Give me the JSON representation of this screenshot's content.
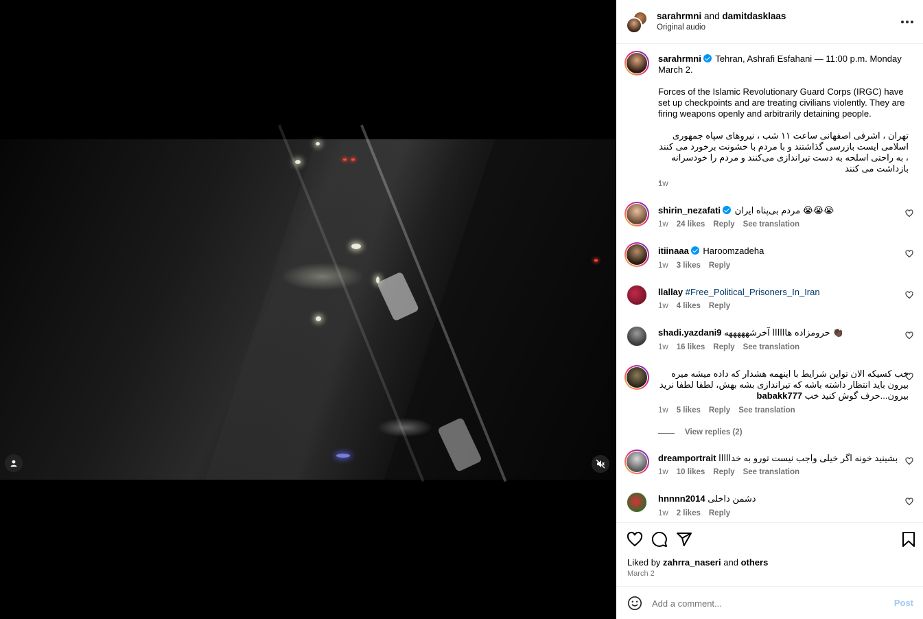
{
  "header": {
    "user1": "sarahrmni",
    "connector": "and",
    "user2": "damitdasklaas",
    "audio": "Original audio",
    "more_icon": "more-horizontal-icon"
  },
  "caption": {
    "username": "sarahrmni",
    "line1": "Tehran, Ashrafi Esfahani — 11:00 p.m. Monday March 2.",
    "line2": "Forces of the Islamic Revolutionary Guard Corps (IRGC) have set up checkpoints and are treating civilians violently. They are firing weapons openly and arbitrarily detaining people.",
    "line3": "تهران ، اشرفی اصفهانی ساعت ۱۱ شب ، نیروهای سپاه جمهوری اسلامی ایست بازرسی گذاشتند و با مردم با خشونت برخورد می کنند ، به راحتی اسلحه به دست تیراندازی می‌کنند و مردم را خودسرانه بازداشت می کنند",
    "line3_end": ".",
    "time": "1w"
  },
  "comments": [
    {
      "username": "shirin_nezafati",
      "verified": true,
      "text": "مردم بی‌پناه ایران 😭😭😭",
      "time": "1w",
      "likes": "24 likes",
      "reply": "Reply",
      "translate": "See translation"
    },
    {
      "username": "itiinaaa",
      "verified": true,
      "text": "Haroomzadeha",
      "time": "1w",
      "likes": "3 likes",
      "reply": "Reply"
    },
    {
      "username": "llallay",
      "verified": false,
      "text": "#Free_Political_Prisoners_In_Iran",
      "time": "1w",
      "likes": "4 likes",
      "reply": "Reply"
    },
    {
      "username": "shadi.yazdani9",
      "verified": false,
      "text": "حرومزاده هاااااا آخرشهههههه 👏🏿",
      "time": "1w",
      "likes": "16 likes",
      "reply": "Reply",
      "translate": "See translation"
    },
    {
      "username": "babakk777",
      "verified": false,
      "text": "خب کسیکه الان تواین شرایط با اینهمه هشدار که داده میشه میره بیرون باید انتظار داشته باشه که تیراندازی بشه بهش، لطفا لطفا نرید بیرون...حرف گوش کنید خب",
      "time": "1w",
      "likes": "5 likes",
      "reply": "Reply",
      "translate": "See translation",
      "view_replies": "View replies (2)"
    },
    {
      "username": "dreamportrait",
      "verified": false,
      "text": "بشینید خونه اگر خیلی واجب نیست تورو به خدااااا",
      "time": "1w",
      "likes": "10 likes",
      "reply": "Reply",
      "translate": "See translation"
    },
    {
      "username": "hnnnn2014",
      "verified": false,
      "text": "دشمن داخلی",
      "time": "1w",
      "likes": "2 likes",
      "reply": "Reply"
    }
  ],
  "actions": {
    "like_icon": "heart-icon",
    "comment_icon": "comment-icon",
    "share_icon": "share-icon",
    "save_icon": "bookmark-icon"
  },
  "likes": {
    "prefix": "Liked by",
    "user": "zahrra_naseri",
    "and": "and",
    "others": "others",
    "date": "March 2"
  },
  "add_comment": {
    "placeholder": "Add a comment...",
    "post": "Post"
  },
  "colors": {
    "accent": "#0095f6",
    "post_disabled": "#9fc9f5",
    "secondary_text": "#737373"
  }
}
